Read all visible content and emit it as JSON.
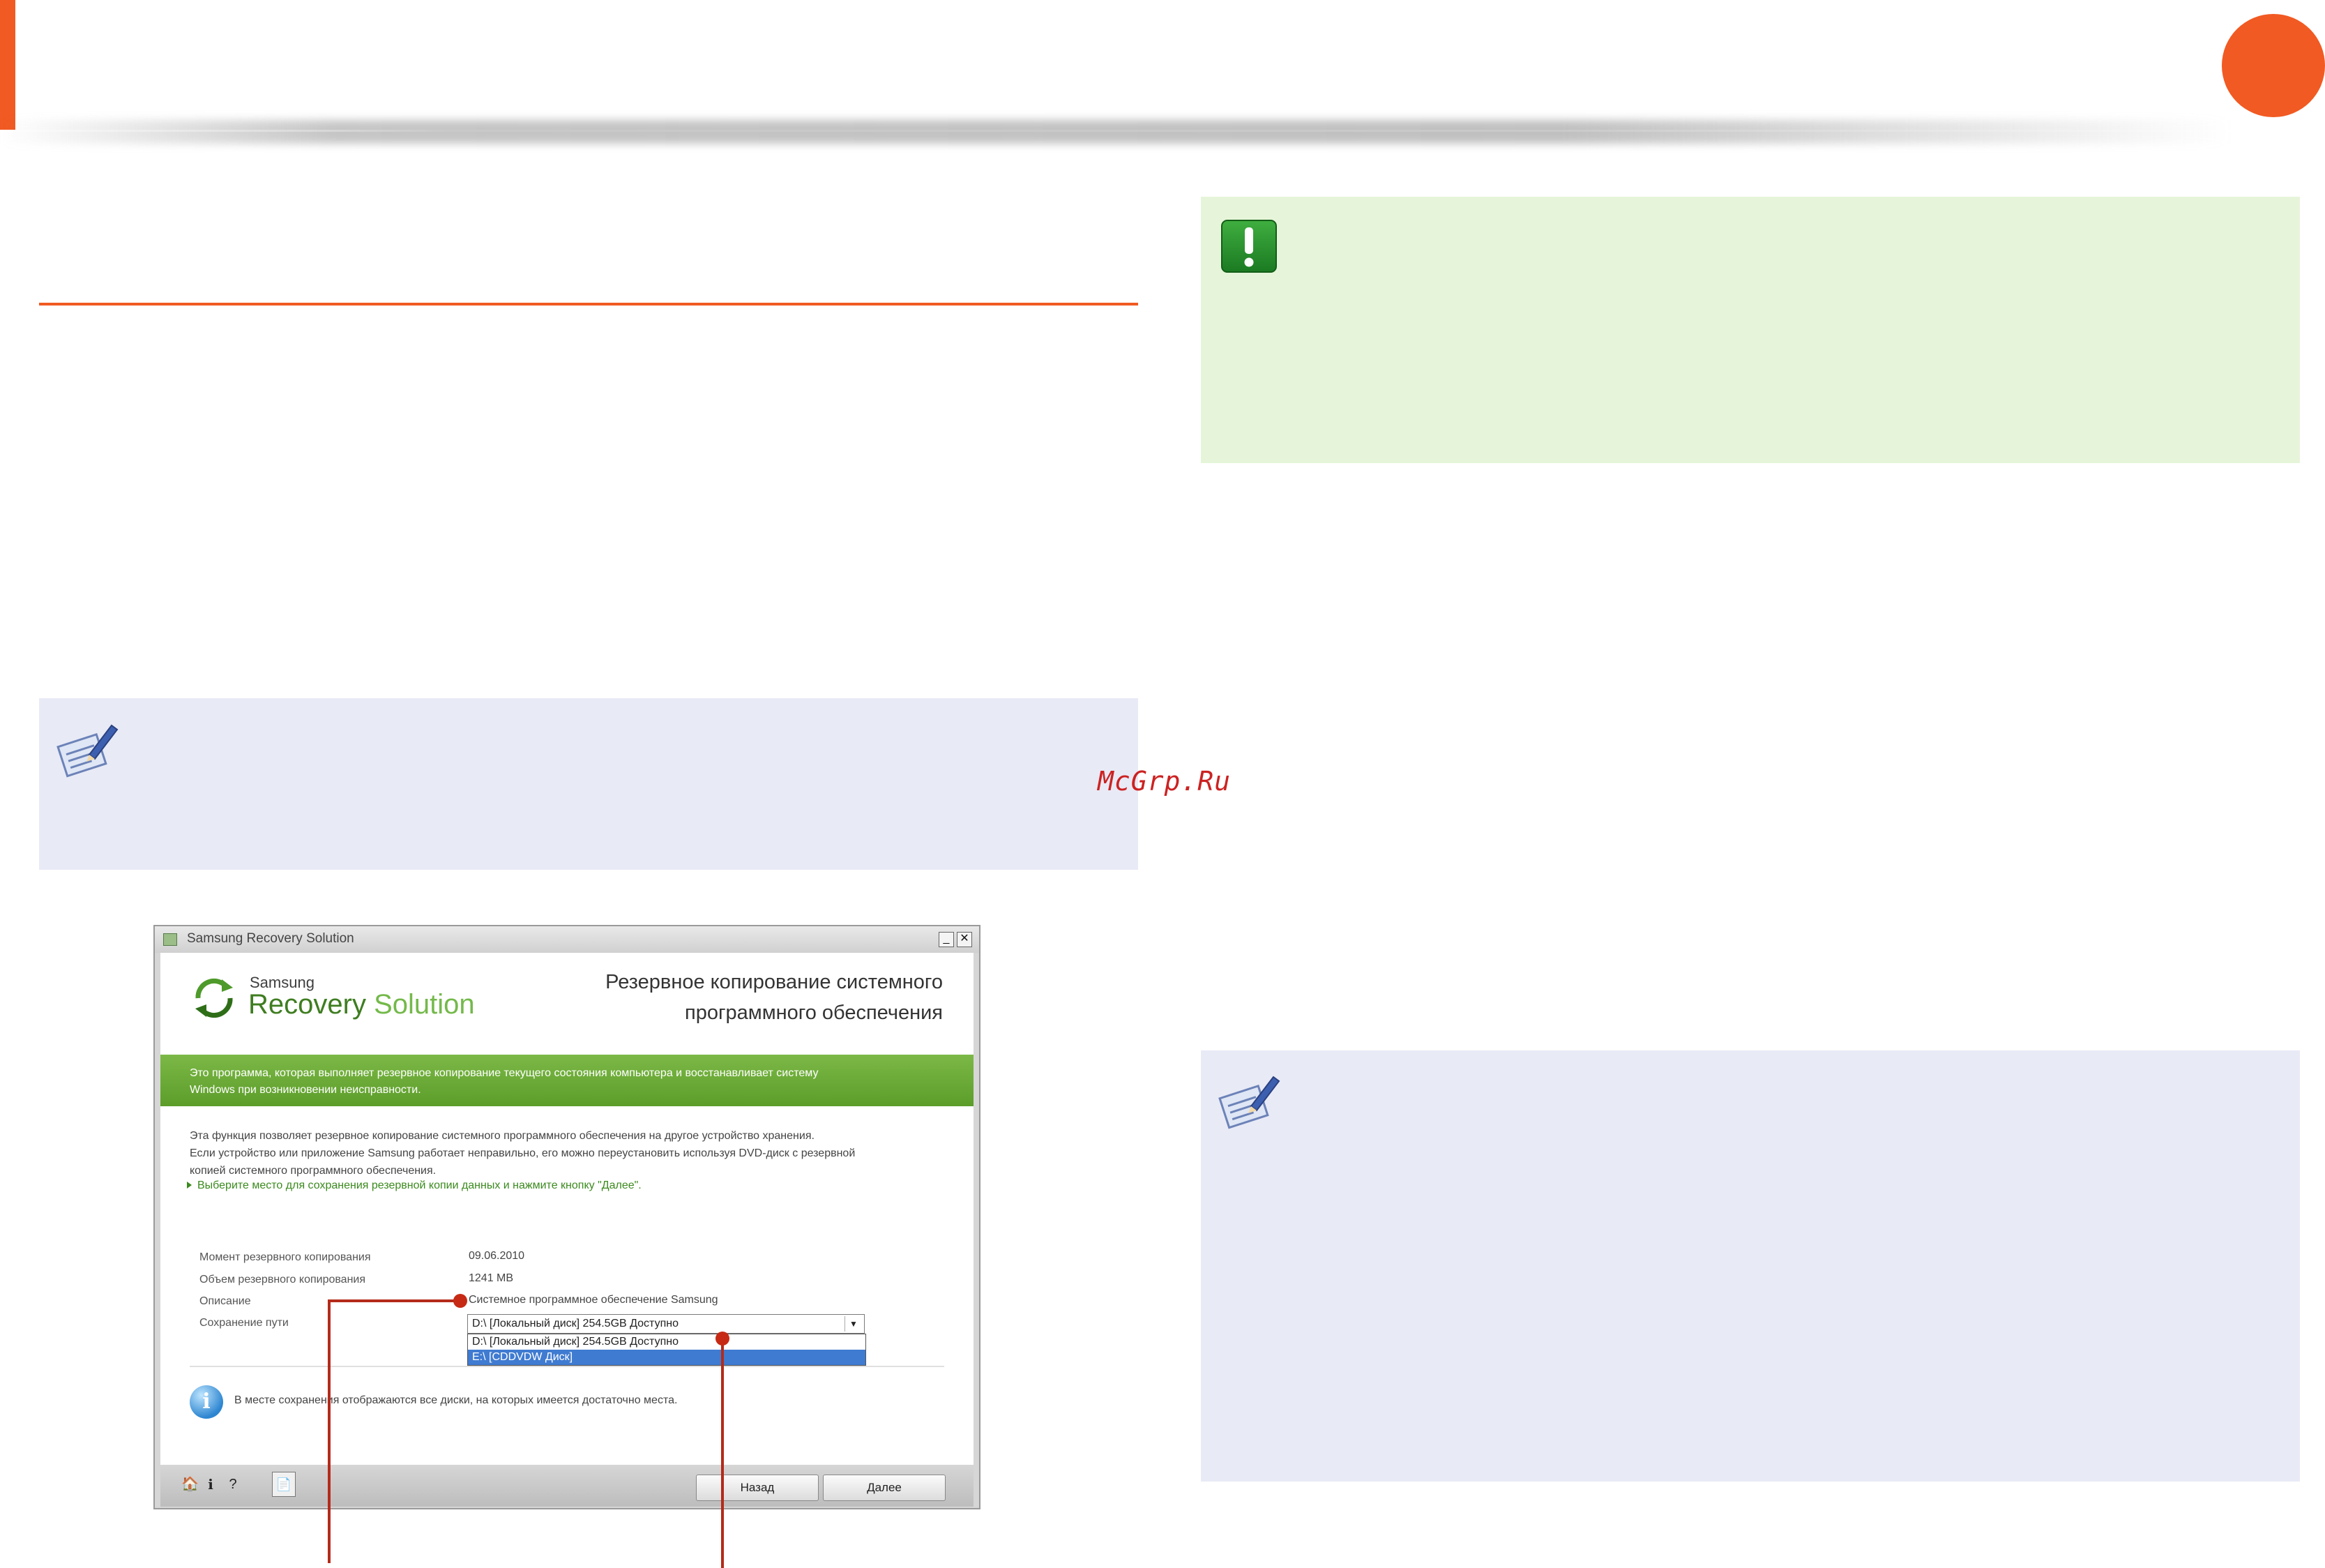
{
  "watermark": "McGrp.Ru",
  "app": {
    "window_title": "Samsung Recovery Solution",
    "brand": {
      "small": "Samsung",
      "main_dark": "Recovery",
      "main_light": "Solution"
    },
    "heading_line1": "Резервное копирование системного",
    "heading_line2": "программного обеспечения",
    "banner_line1": "Это программа, которая выполняет резервное копирование текущего состояния компьютера и восстанавливает систему",
    "banner_line2": "Windows при возникновении неисправности.",
    "body_line1": "Эта функция позволяет резервное копирование системного программного обеспечения на другое устройство хранения.",
    "body_line2": "Если устройство или приложение Samsung работает неправильно, его можно переустановить используя DVD-диск с резервной",
    "body_line3": "копией системного программного обеспечения.",
    "instruction": "Выберите место для сохранения резервной копии данных и нажмите кнопку \"Далее\".",
    "fields": {
      "backup_time_label": "Момент резервного копирования",
      "backup_time_value": "09.06.2010",
      "backup_size_label": "Объем резервного копирования",
      "backup_size_value": "1241 MB",
      "description_label": "Описание",
      "description_value": "Системное программное обеспечение Samsung",
      "save_path_label": "Сохранение пути",
      "save_path_selected": "D:\\ [Локальный диск]  254.5GB Доступно",
      "save_path_options": [
        "D:\\ [Локальный диск]  254.5GB Доступно",
        "E:\\ [CDDVDW Диск]"
      ]
    },
    "info_text": "В месте сохранения отображаются все диски, на которых имеется достаточно места.",
    "toolbar": {
      "home_glyph": "🏠",
      "about_glyph": "i",
      "help_glyph": "?",
      "doc_glyph": "📄"
    },
    "back_label": "Назад",
    "next_label": "Далее",
    "minimize_glyph": "_",
    "close_glyph": "✕",
    "dropdown_glyph": "▼"
  },
  "colors": {
    "accent_orange": "#f15a22",
    "note_bg": "#e8eaf6",
    "caution_bg": "#e6f5d9",
    "banner_green": "#6aaa36",
    "selection_blue": "#3f7bd1",
    "callout_red": "#b52a1a"
  },
  "icons": [
    "pencil-note-icon",
    "caution-exclamation-icon",
    "refresh-logo-icon",
    "info-icon",
    "home-icon",
    "help-icon",
    "document-icon"
  ]
}
